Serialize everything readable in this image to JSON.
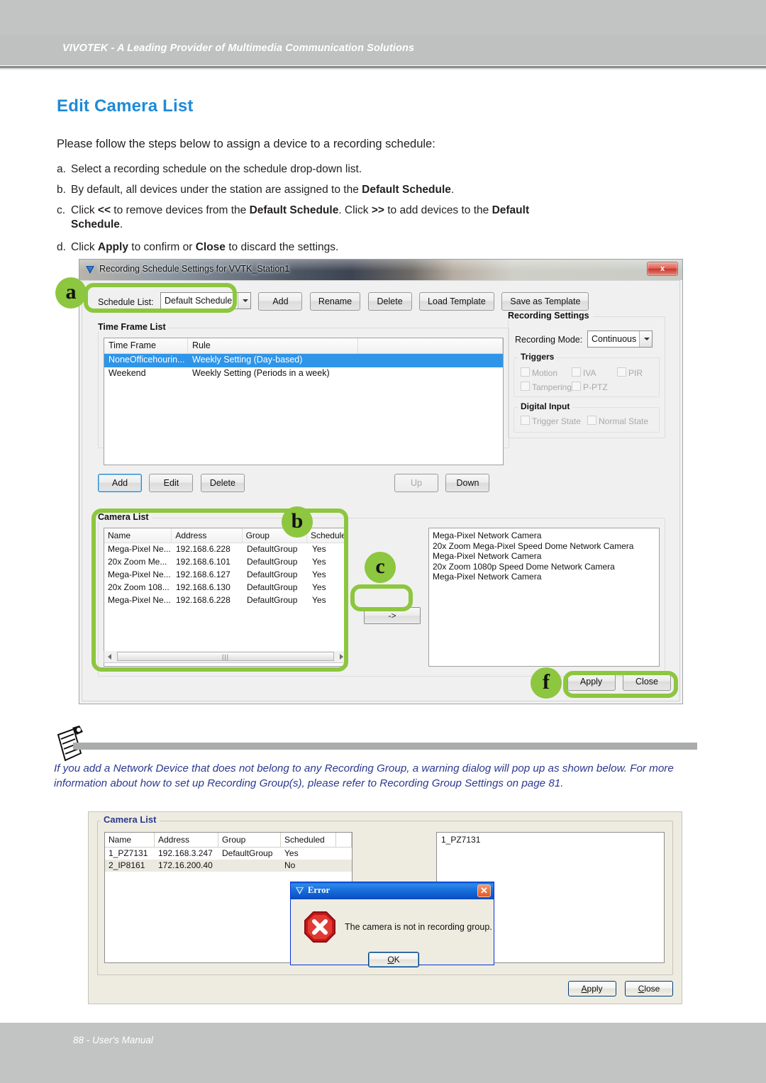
{
  "header": {
    "banner": "VIVOTEK - A Leading Provider of Multimedia Communication Solutions"
  },
  "doc": {
    "title": "Edit Camera List",
    "intro": "Please follow the steps below to assign a device to a recording schedule:",
    "steps": [
      {
        "label": "a.",
        "text": "Select a recording schedule on the schedule drop-down list."
      },
      {
        "label": "b.",
        "text_1": "By default, all devices under the station are assigned to the ",
        "bold_1": "Default Schedule",
        "text_2": "."
      },
      {
        "label": "c.",
        "text_1": "Click ",
        "bold_1": "<<",
        "text_2": " to remove devices from the ",
        "bold_2": "Default Schedule",
        "text_3": ". Click ",
        "bold_3": ">>",
        "text_4": " to add devices to the ",
        "bold_4": "Default",
        "cont_bold": "Schedule",
        "cont_text": "."
      },
      {
        "label": "d.",
        "text_1": "Click ",
        "bold_1": "Apply",
        "text_2": " to confirm or ",
        "bold_2": "Close",
        "text_3": " to discard the settings."
      }
    ]
  },
  "dialog": {
    "title": "Recording Schedule Settings for VVTK_Station1",
    "close_label": "x",
    "toolbar": {
      "schedule_list_label": "Schedule List:",
      "schedule_value": "Default Schedule",
      "add": "Add",
      "rename": "Rename",
      "delete": "Delete",
      "load_template": "Load Template",
      "save_as_template": "Save as Template"
    },
    "time_frame_list": {
      "title": "Time Frame List",
      "columns": [
        "Time Frame",
        "Rule",
        ""
      ],
      "rows": [
        {
          "time_frame": "NoneOfficehourin...",
          "rule": "Weekly Setting (Day-based)",
          "selected": true
        },
        {
          "time_frame": "Weekend",
          "rule": "Weekly Setting (Periods in a week)",
          "selected": false
        }
      ]
    },
    "recording_settings": {
      "title": "Recording Settings",
      "mode_label": "Recording Mode:",
      "mode_value": "Continuous",
      "triggers": {
        "title": "Triggers",
        "items": [
          "Motion",
          "IVA",
          "PIR",
          "Tampering",
          "P-PTZ"
        ]
      },
      "digital_input": {
        "title": "Digital Input",
        "items": [
          "Trigger State",
          "Normal State"
        ]
      }
    },
    "mid_buttons": {
      "add": "Add",
      "edit": "Edit",
      "delete": "Delete",
      "up": "Up",
      "down": "Down"
    },
    "camera_list": {
      "title": "Camera List",
      "columns": [
        "Name",
        "Address",
        "Group",
        "Schedule"
      ],
      "rows": [
        {
          "name": "Mega-Pixel Ne...",
          "address": "192.168.6.228",
          "group": "DefaultGroup",
          "scheduled": "Yes"
        },
        {
          "name": "20x Zoom Me...",
          "address": "192.168.6.101",
          "group": "DefaultGroup",
          "scheduled": "Yes"
        },
        {
          "name": "Mega-Pixel Ne...",
          "address": "192.168.6.127",
          "group": "DefaultGroup",
          "scheduled": "Yes"
        },
        {
          "name": "20x Zoom 108...",
          "address": "192.168.6.130",
          "group": "DefaultGroup",
          "scheduled": "Yes"
        },
        {
          "name": "Mega-Pixel Ne...",
          "address": "192.168.6.228",
          "group": "DefaultGroup",
          "scheduled": "Yes"
        }
      ],
      "transfer_button": "->",
      "selected_cameras": [
        "Mega-Pixel Network Camera",
        "20x Zoom Mega-Pixel Speed Dome Network Camera",
        "Mega-Pixel Network Camera",
        "20x Zoom 1080p Speed Dome Network Camera",
        "Mega-Pixel Network Camera"
      ]
    },
    "apply": "Apply",
    "close": "Close"
  },
  "callouts": {
    "a": "a",
    "b": "b",
    "c": "c",
    "f": "f",
    "color": "#8dc63f"
  },
  "note": {
    "text": "If you add a Network Device that does not belong to any Recording Group, a warning dialog will pop up as shown below. For more information about how to set up Recording Group(s), please refer to Recording Group Settings on page 81."
  },
  "dialog2": {
    "camera_list": {
      "title": "Camera List",
      "columns": [
        "Name",
        "Address",
        "Group",
        "Scheduled",
        ""
      ],
      "rows": [
        {
          "name": "1_PZ7131",
          "address": "192.168.3.247",
          "group": "DefaultGroup",
          "scheduled": "Yes"
        },
        {
          "name": "2_IP8161",
          "address": "172.16.200.40",
          "group": "",
          "scheduled": "No"
        }
      ],
      "selected_cameras": [
        "1_PZ7131"
      ]
    },
    "apply": "Apply",
    "close": "Close"
  },
  "error_dialog": {
    "title": "Error",
    "close_label": "✕",
    "message": "The camera is not in recording group.",
    "ok": "OK"
  },
  "footer": {
    "text": "88 - User's Manual"
  }
}
